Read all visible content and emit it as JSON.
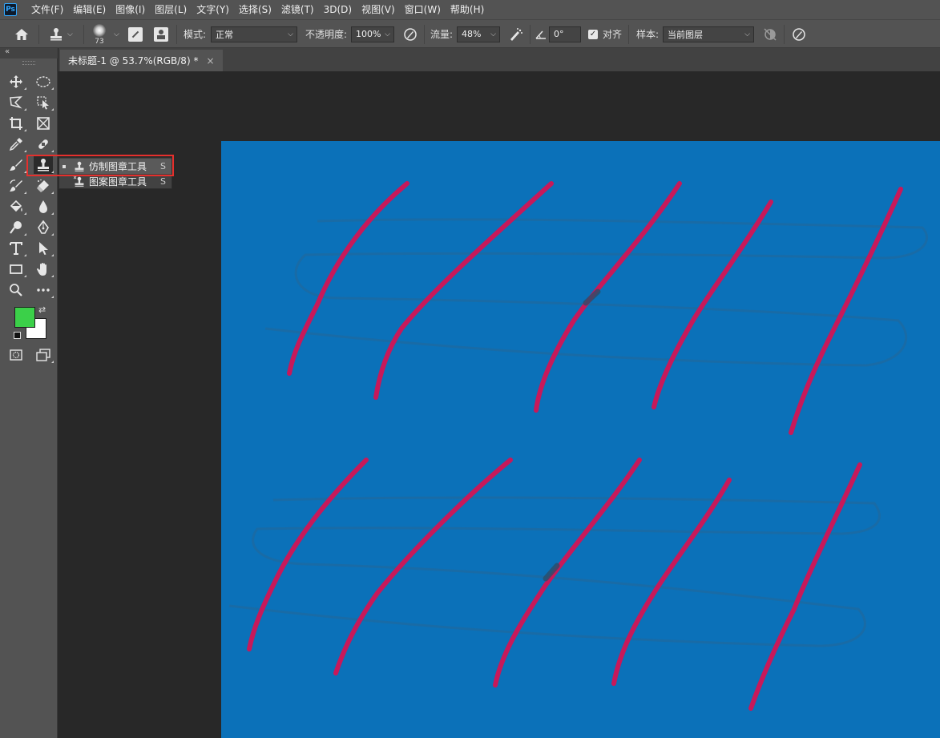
{
  "app": {
    "logo": "Ps"
  },
  "menu": [
    "文件(F)",
    "编辑(E)",
    "图像(I)",
    "图层(L)",
    "文字(Y)",
    "选择(S)",
    "滤镜(T)",
    "3D(D)",
    "视图(V)",
    "窗口(W)",
    "帮助(H)"
  ],
  "options": {
    "brush_size": "73",
    "mode_label": "模式:",
    "mode_value": "正常",
    "opacity_label": "不透明度:",
    "opacity_value": "100%",
    "flow_label": "流量:",
    "flow_value": "48%",
    "angle_value": "0°",
    "align_label": "对齐",
    "align_checked": true,
    "sample_label": "样本:",
    "sample_value": "当前图层"
  },
  "document_tab": {
    "title": "未标题-1 @ 53.7%(RGB/8) *",
    "close": "×"
  },
  "flyout": {
    "items": [
      {
        "label": "仿制图章工具",
        "shortcut": "S",
        "selected": true
      },
      {
        "label": "图案图章工具",
        "shortcut": "S",
        "selected": false
      }
    ]
  },
  "colors": {
    "foreground": "#3bd049",
    "background": "#ffffff",
    "canvas": "#0b71b9",
    "strokes": "#c7195a",
    "highlight": "#e5302d"
  },
  "icons": {
    "home": "home-icon",
    "stamp": "clone-stamp-icon",
    "move": "move-icon",
    "marquee": "ellipse-marquee-icon",
    "lasso": "polygon-lasso-icon",
    "object_select": "object-select-icon",
    "crop": "crop-icon",
    "frame": "frame-icon",
    "eyedropper": "eyedropper-icon",
    "healing": "healing-brush-icon",
    "brush": "brush-icon",
    "history_brush": "history-brush-icon",
    "eraser": "eraser-icon",
    "paint_bucket": "paint-bucket-icon",
    "blur": "blur-drop-icon",
    "dodge": "dodge-icon",
    "pen": "pen-icon",
    "type": "type-icon",
    "path_select": "path-select-icon",
    "rectangle": "rectangle-icon",
    "hand": "hand-icon",
    "zoom": "zoom-icon",
    "more": "more-icon"
  }
}
